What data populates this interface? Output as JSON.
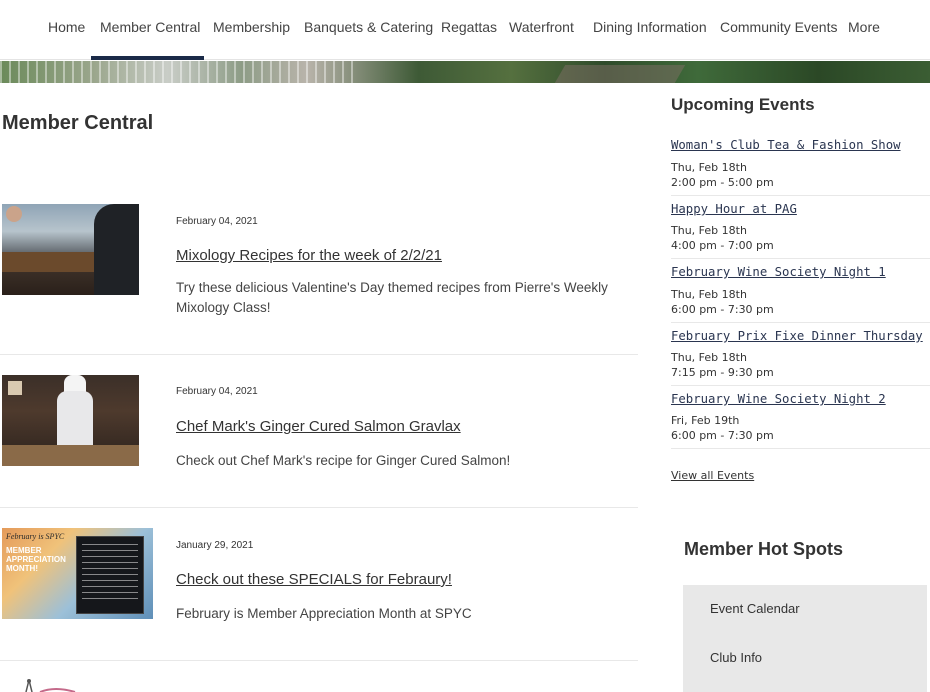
{
  "nav": {
    "items": [
      "Home",
      "Member Central",
      "Membership",
      "Banquets & Catering",
      "Regattas",
      "Waterfront",
      "Dining Information",
      "Community Events",
      "More"
    ],
    "active": "Member Central"
  },
  "page": {
    "title": "Member Central"
  },
  "articles": [
    {
      "date": "February 04, 2021",
      "title": "Mixology Recipes for the week of 2/2/21",
      "description": "Try these delicious Valentine's Day themed recipes from Pierre's Weekly Mixology Class!"
    },
    {
      "date": "February 04, 2021",
      "title": "Chef Mark's Ginger Cured Salmon Gravlax",
      "description": "Check out Chef Mark's recipe for Ginger Cured Salmon!"
    },
    {
      "date": "January 29, 2021",
      "title": "Check out these SPECIALS for Febraury!",
      "description": "February is Member Appreciation Month at SPYC"
    }
  ],
  "thumb3": {
    "script": "February is SPYC",
    "headline": "MEMBER APPRECIATION MONTH!"
  },
  "upcoming": {
    "heading": "Upcoming Events",
    "events": [
      {
        "title": "Woman's Club Tea & Fashion Show",
        "date": "Thu, Feb 18th",
        "time": "2:00 pm - 5:00 pm"
      },
      {
        "title": "Happy Hour at PAG",
        "date": "Thu, Feb 18th",
        "time": "4:00 pm - 7:00 pm"
      },
      {
        "title": "February Wine Society Night 1",
        "date": "Thu, Feb 18th",
        "time": "6:00 pm - 7:30 pm"
      },
      {
        "title": "February Prix Fixe Dinner Thursday",
        "date": "Thu, Feb 18th",
        "time": "7:15 pm - 9:30 pm"
      },
      {
        "title": "February Wine Society Night 2",
        "date": "Fri, Feb 19th",
        "time": "6:00 pm - 7:30 pm"
      }
    ],
    "view_all": "View all Events"
  },
  "hot_spots": {
    "heading": "Member Hot Spots",
    "items": [
      "Event Calendar",
      "Club Info"
    ]
  }
}
